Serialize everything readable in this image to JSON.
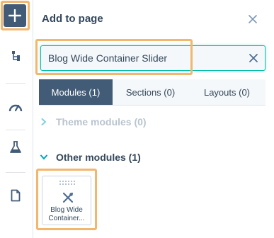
{
  "rail": {
    "add_button_label": "+",
    "items": [
      {
        "icon": "tree-structure-icon"
      },
      {
        "icon": "speedometer-icon"
      },
      {
        "icon": "flask-icon"
      },
      {
        "icon": "document-icon"
      }
    ]
  },
  "panel": {
    "title": "Add to page",
    "search": {
      "value": "Blog Wide Container Slider",
      "placeholder": ""
    },
    "tabs": [
      {
        "label": "Modules (1)",
        "active": true
      },
      {
        "label": "Sections (0)",
        "active": false
      },
      {
        "label": "Layouts (0)",
        "active": false
      }
    ],
    "sections": [
      {
        "label": "Theme modules (0)",
        "expanded": false
      },
      {
        "label": "Other modules (1)",
        "expanded": true
      }
    ],
    "modules": [
      {
        "label": "Blog Wide Container..."
      }
    ]
  },
  "colors": {
    "accent": "#425b76",
    "focus": "#00bda5",
    "highlight": "#f2b66d",
    "teal_chevron": "#00a4bd"
  }
}
